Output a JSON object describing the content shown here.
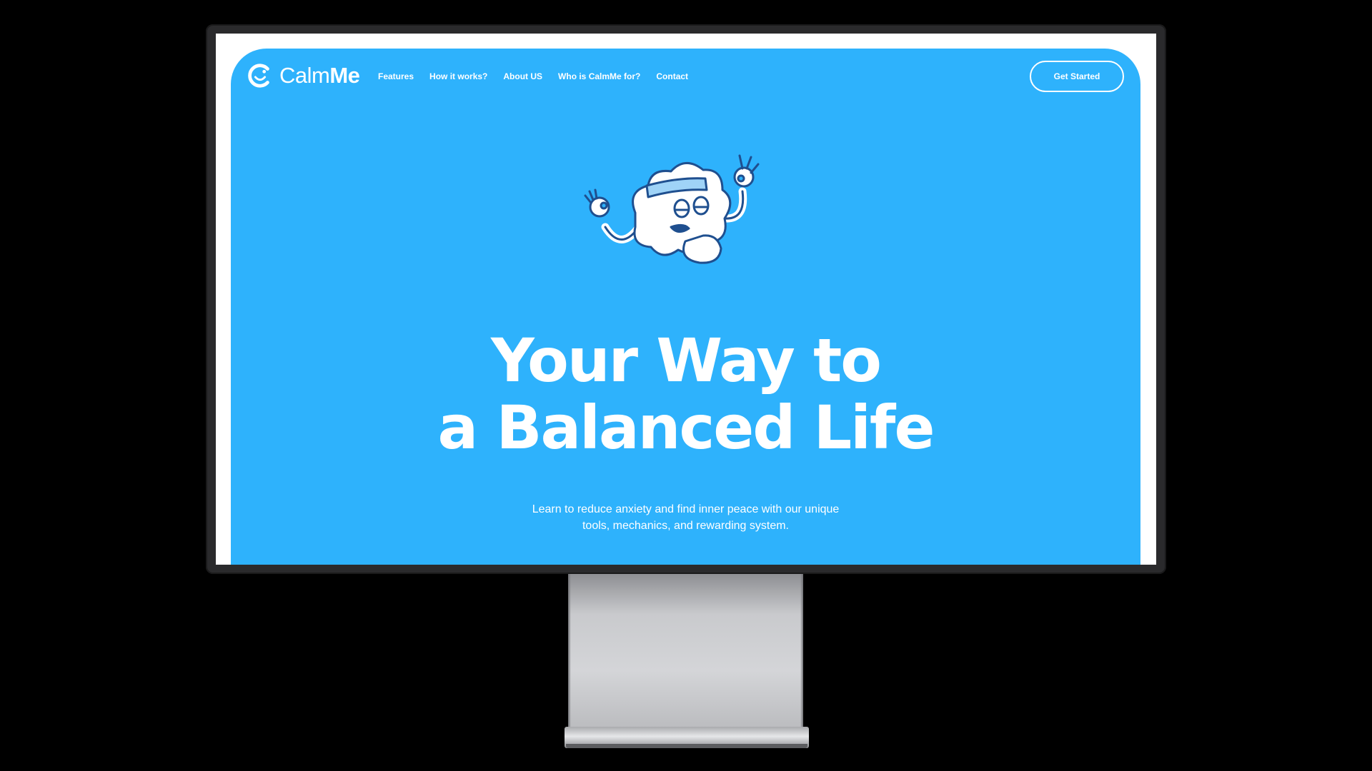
{
  "brand": {
    "name_regular": "Calm",
    "name_bold": "Me",
    "logo_icon": "smiling-c-logo-icon",
    "accent": "#2eb2fc"
  },
  "nav": {
    "links": [
      {
        "label": "Features"
      },
      {
        "label": "How it works?"
      },
      {
        "label": "About US"
      },
      {
        "label": "Who is CalmMe for?"
      },
      {
        "label": "Contact"
      }
    ],
    "cta_label": "Get Started"
  },
  "hero": {
    "mascot_icon": "meditating-cloud-mascot-icon",
    "headline_line1": "Your Way to",
    "headline_line2": "a Balanced Life",
    "subtext_line1": "Learn to reduce anxiety and find inner peace with our unique",
    "subtext_line2": "tools, mechanics, and rewarding system."
  },
  "device": {
    "type": "desktop-monitor-mockup",
    "bezel_color": "#2a2a2c",
    "stand_color": "#c9cacd",
    "background": "#000000"
  }
}
